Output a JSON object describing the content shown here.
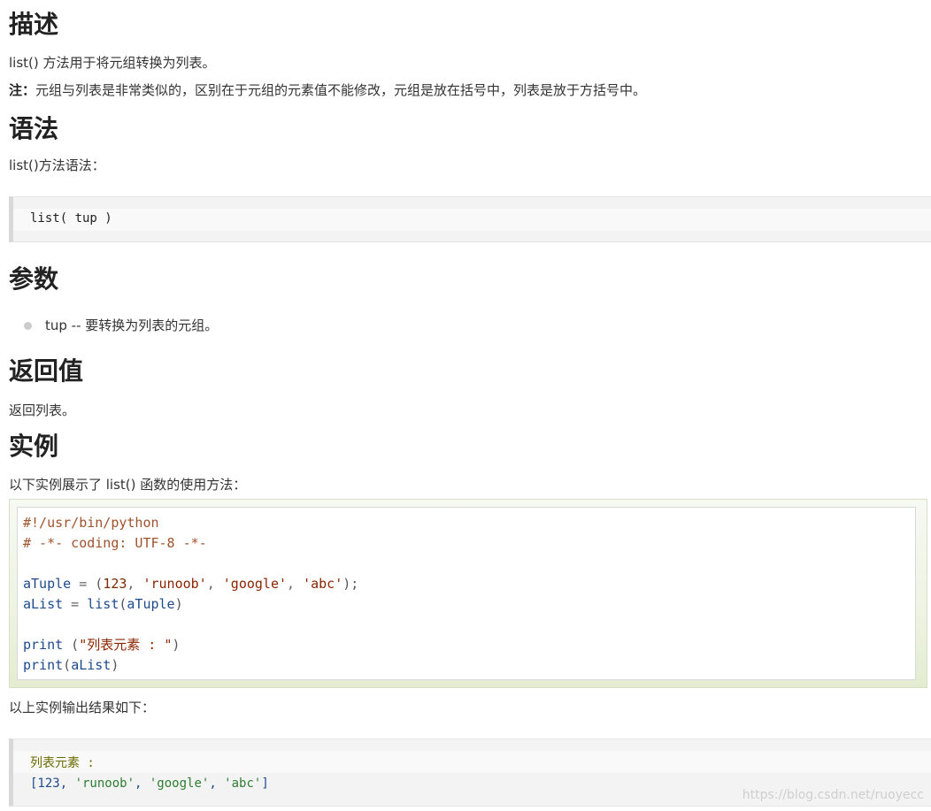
{
  "sections": {
    "description": {
      "heading": "描述",
      "text": "list() 方法用于将元组转换为列表。",
      "note_label": "注：",
      "note_text": "元组与列表是非常类似的，区别在于元组的元素值不能修改，元组是放在括号中，列表是放于方括号中。"
    },
    "syntax": {
      "heading": "语法",
      "intro": "list()方法语法：",
      "code": "list( tup )"
    },
    "params": {
      "heading": "参数",
      "items": [
        "tup -- 要转换为列表的元组。"
      ]
    },
    "return_value": {
      "heading": "返回值",
      "text": "返回列表。"
    },
    "example": {
      "heading": "实例",
      "intro": "以下实例展示了 list() 函数的使用方法：",
      "code_lines": {
        "l1": "#!/usr/bin/python",
        "l2": "# -*- coding: UTF-8 -*-",
        "l4_name": "aTuple",
        "l4_eq": " = ",
        "l4_open": "(",
        "l4_num": "123",
        "l4_comma1": ", ",
        "l4_s1": "'runoob'",
        "l4_comma2": ", ",
        "l4_s2": "'google'",
        "l4_comma3": ", ",
        "l4_s3": "'abc'",
        "l4_close": ");",
        "l5_name": "aList",
        "l5_eq": " = ",
        "l5_func": "list",
        "l5_open": "(",
        "l5_arg": "aTuple",
        "l5_close": ")",
        "l7_func": "print",
        "l7_open": " (",
        "l7_str": "\"列表元素 : \"",
        "l7_close": ")",
        "l8_func": "print",
        "l8_open": "(",
        "l8_arg": "aList",
        "l8_close": ")"
      },
      "output_intro": "以上实例输出结果如下：",
      "output_line1": "列表元素 :",
      "output_line2_prefix": "[123, ",
      "output_s1": "'runoob'",
      "output_sep1": ", ",
      "output_s2": "'google'",
      "output_sep2": ", ",
      "output_s3": "'abc'",
      "output_suffix": "]"
    }
  },
  "watermark": "https://blog.csdn.net/ruoyecc",
  "colors": {
    "heading": "#222222",
    "text": "#333333",
    "code_name": "#1e4a8c",
    "code_comment": "#a0522d",
    "code_string": "#8b2500"
  }
}
